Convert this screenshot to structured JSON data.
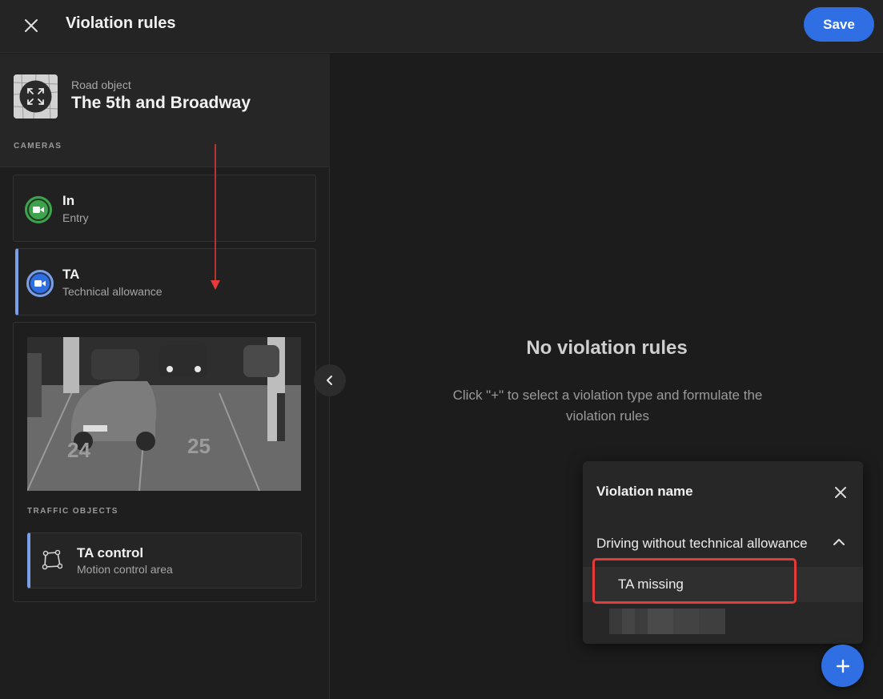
{
  "header": {
    "title": "Violation rules",
    "save_label": "Save",
    "close_icon": "close-icon"
  },
  "road_object": {
    "label": "Road object",
    "name": "The 5th and Broadway",
    "thumbnail_icon": "fullscreen-icon"
  },
  "cameras": {
    "section_label": "CAMERAS",
    "items": [
      {
        "title": "In",
        "subtitle": "Entry",
        "icon": "camera-icon",
        "color": "#3fa34d",
        "selected": false
      },
      {
        "title": "TA",
        "subtitle": "Technical allowance",
        "icon": "camera-icon",
        "color": "#2f6fe3",
        "selected": true
      }
    ]
  },
  "traffic_objects": {
    "section_label": "TRAFFIC OBJECTS",
    "items": [
      {
        "title": "TA control",
        "subtitle": "Motion control area",
        "icon": "polygon-icon"
      }
    ]
  },
  "main": {
    "empty_title": "No violation rules",
    "empty_description": "Click \"+\" to select a violation type and formulate the violation rules"
  },
  "popup": {
    "title": "Violation name",
    "group_label": "Driving without technical allowance",
    "options": [
      "TA missing"
    ]
  },
  "colors": {
    "accent": "#2f6fe3",
    "annotation": "#e53b3b",
    "selected_bar": "#7a9fe8"
  }
}
